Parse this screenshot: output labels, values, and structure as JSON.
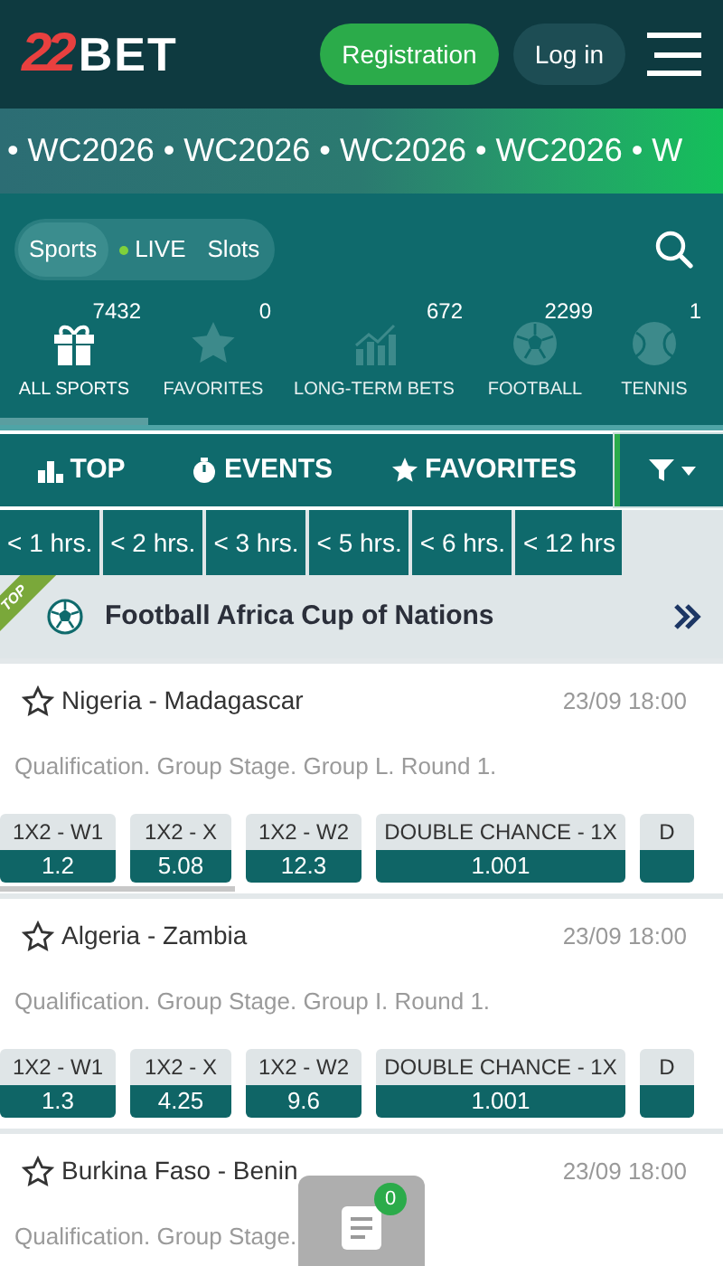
{
  "header": {
    "logo": {
      "mark": "22",
      "word": "BET"
    },
    "buttons": [
      {
        "label": "Registration",
        "kind": "primary"
      },
      {
        "label": "Log in",
        "kind": "secondary"
      }
    ]
  },
  "banner": {
    "text": "• WC2026 • WC2026 • WC2026 • WC2026 • W"
  },
  "mode_switch": [
    {
      "label": "Sports",
      "selected": true,
      "live": false
    },
    {
      "label": "LIVE",
      "selected": false,
      "live": true
    },
    {
      "label": "Slots",
      "selected": false,
      "live": false
    }
  ],
  "sports": [
    {
      "label": "ALL SPORTS",
      "count": "7432",
      "kind": "gift",
      "selected": true
    },
    {
      "label": "FAVORITES",
      "count": "0",
      "kind": "star",
      "selected": false
    },
    {
      "label": "LONG-TERM BETS",
      "count": "672",
      "kind": "chart",
      "selected": false
    },
    {
      "label": "FOOTBALL",
      "count": "2299",
      "kind": "ball",
      "selected": false
    },
    {
      "label": "TENNIS",
      "count": "1",
      "kind": "tennis",
      "selected": false
    }
  ],
  "tabs": [
    {
      "label": "TOP",
      "kind": "top"
    },
    {
      "label": "EVENTS",
      "kind": "events"
    },
    {
      "label": "FAVORITES",
      "kind": "favorites"
    }
  ],
  "time_filters": [
    "< 1 hrs.",
    "< 2 hrs.",
    "< 3 hrs.",
    "< 5 hrs.",
    "< 6 hrs.",
    "< 12 hrs"
  ],
  "section": {
    "ribbon": "TOP",
    "title": "Football Africa Cup of Nations"
  },
  "events": [
    {
      "teams": "Nigeria - Madagascar",
      "time": "23/09 18:00",
      "stage": "Qualification. Group Stage. Group L. Round 1.",
      "markets": [
        {
          "label": "1X2 - W1",
          "value": "1.2"
        },
        {
          "label": "1X2 - X",
          "value": "5.08"
        },
        {
          "label": "1X2 - W2",
          "value": "12.3"
        },
        {
          "label": "DOUBLE CHANCE - 1X",
          "value": "1.001"
        },
        {
          "label": "D"
        }
      ]
    },
    {
      "teams": "Algeria - Zambia",
      "time": "23/09 18:00",
      "stage": "Qualification. Group Stage. Group I. Round 1.",
      "markets": [
        {
          "label": "1X2 - W1",
          "value": "1.3"
        },
        {
          "label": "1X2 - X",
          "value": "4.25"
        },
        {
          "label": "1X2 - W2",
          "value": "9.6"
        },
        {
          "label": "DOUBLE CHANCE - 1X",
          "value": "1.001"
        },
        {
          "label": "D"
        }
      ]
    },
    {
      "teams": "Burkina Faso - Benin",
      "time": "23/09 18:00",
      "stage": "Qualification. Group Stage."
    }
  ],
  "bet_slip": {
    "count": "0"
  }
}
